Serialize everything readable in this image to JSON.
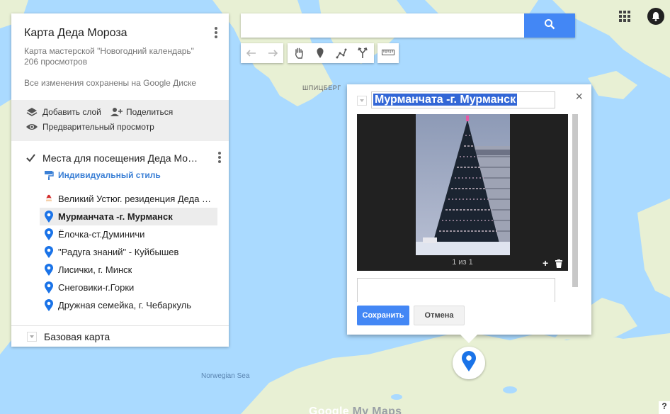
{
  "map": {
    "sea_label": "Norwegian Sea",
    "region_label": "ШПИЦБЕРГ",
    "water_color": "#aadaff",
    "land_color": "#e8f0d4"
  },
  "panel": {
    "title": "Карта Деда Мороза",
    "subtitle": "Карта мастерской \"Новогодний календарь\"",
    "views": "206 просмотров",
    "saved_status": "Все изменения сохранены на Google Диске",
    "actions": {
      "add_layer": "Добавить слой",
      "share": "Поделиться",
      "preview": "Предварительный просмотр"
    },
    "layer": {
      "title": "Места для посещения Деда Мороза",
      "style_label": "Индивидуальный стиль",
      "places": [
        {
          "label": "Великий Устюг. резиденция Деда Мороза",
          "icon": "santa-icon"
        },
        {
          "label": "Мурманчата -г. Мурманск",
          "icon": "map-pin-icon"
        },
        {
          "label": "Ёлочка-ст.Думиничи",
          "icon": "map-pin-icon"
        },
        {
          "label": "\"Радуга знаний\" - Куйбышев",
          "icon": "map-pin-icon"
        },
        {
          "label": "Лисички, г. Минск",
          "icon": "map-pin-icon"
        },
        {
          "label": "Снеговики-г.Горки",
          "icon": "map-pin-icon"
        },
        {
          "label": "Дружная семейка,  г. Чебаркуль",
          "icon": "map-pin-icon"
        }
      ]
    },
    "basemap_label": "Базовая карта"
  },
  "search": {
    "placeholder": ""
  },
  "toolbar": {
    "tools": [
      "undo-icon",
      "redo-icon",
      "hand-icon",
      "marker-icon",
      "draw-line-icon",
      "directions-icon",
      "ruler-icon"
    ]
  },
  "popup": {
    "title": "Мурманчата -г. Мурманск",
    "media_counter": "1 из 1",
    "add_media": "+",
    "description": "",
    "save_label": "Сохранить",
    "cancel_label": "Отмена",
    "close_label": "×"
  },
  "footer": {
    "logo_google": "Google",
    "logo_product": "My Maps",
    "help": "?"
  },
  "colors": {
    "accent": "#4387f5",
    "pin": "#1a73e8",
    "selection": "#3367d6"
  }
}
